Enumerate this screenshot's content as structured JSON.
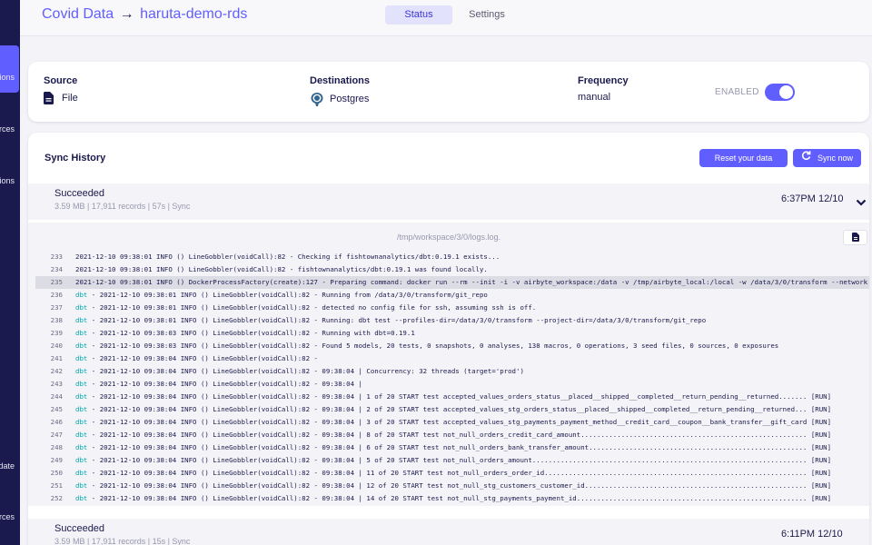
{
  "sidebar": {
    "items": [
      {
        "label": "Connections"
      },
      {
        "label": "Sources"
      },
      {
        "label": "Destinations"
      },
      {
        "label": "Update"
      },
      {
        "label": "Resources"
      }
    ]
  },
  "header": {
    "source_name": "Covid Data",
    "arrow": "→",
    "destination_name": "haruta-demo-rds",
    "tabs": [
      {
        "label": "Status",
        "active": true
      },
      {
        "label": "Settings",
        "active": false
      }
    ]
  },
  "connection": {
    "source_label": "Source",
    "source_value": "File",
    "destinations_label": "Destinations",
    "destinations_value": "Postgres",
    "frequency_label": "Frequency",
    "frequency_value": "manual",
    "enabled_label": "ENABLED",
    "enabled": true
  },
  "history": {
    "title": "Sync History",
    "reset_label": "Reset your data",
    "sync_label": "Sync now",
    "jobs": [
      {
        "status": "Succeeded",
        "meta": "3.59 MB | 17,911 records | 57s | Sync",
        "time": "6:37PM 12/10"
      },
      {
        "status": "Succeeded",
        "meta": "3.59 MB | 17,911 records | 15s | Sync",
        "time": "6:11PM 12/10"
      }
    ],
    "log_path": "/tmp/workspace/3/0/logs.log.",
    "log_lines": [
      {
        "n": "233",
        "dbt": false,
        "text": "2021-12-10 09:38:01 INFO () LineGobbler(voidCall):82 - Checking if fishtownanalytics/dbt:0.19.1 exists..."
      },
      {
        "n": "234",
        "dbt": false,
        "text": "2021-12-10 09:38:01 INFO () LineGobbler(voidCall):82 - fishtownanalytics/dbt:0.19.1 was found locally."
      },
      {
        "n": "235",
        "dbt": false,
        "hl": true,
        "text": "2021-12-10 09:38:01 INFO () DockerProcessFactory(create):127 - Preparing command: docker run --rm --init -i -v airbyte_workspace:/data -v /tmp/airbyte_local:/local -w /data/3/0/transform --network"
      },
      {
        "n": "236",
        "dbt": true,
        "text": " - 2021-12-10 09:38:01 INFO () LineGobbler(voidCall):82 - Running from /data/3/0/transform/git_repo"
      },
      {
        "n": "237",
        "dbt": true,
        "text": " - 2021-12-10 09:38:01 INFO () LineGobbler(voidCall):82 - detected no config file for ssh, assuming ssh is off."
      },
      {
        "n": "238",
        "dbt": true,
        "text": " - 2021-12-10 09:38:01 INFO () LineGobbler(voidCall):82 - Running: dbt test --profiles-dir=/data/3/0/transform --project-dir=/data/3/0/transform/git_repo"
      },
      {
        "n": "239",
        "dbt": true,
        "text": " - 2021-12-10 09:38:03 INFO () LineGobbler(voidCall):82 - Running with dbt=0.19.1"
      },
      {
        "n": "240",
        "dbt": true,
        "text": " - 2021-12-10 09:38:03 INFO () LineGobbler(voidCall):82 - Found 5 models, 20 tests, 0 snapshots, 0 analyses, 138 macros, 0 operations, 3 seed files, 0 sources, 0 exposures"
      },
      {
        "n": "241",
        "dbt": true,
        "text": " - 2021-12-10 09:38:04 INFO () LineGobbler(voidCall):82 -"
      },
      {
        "n": "242",
        "dbt": true,
        "text": " - 2021-12-10 09:38:04 INFO () LineGobbler(voidCall):82 - 09:38:04 | Concurrency: 32 threads (target='prod')"
      },
      {
        "n": "243",
        "dbt": true,
        "text": " - 2021-12-10 09:38:04 INFO () LineGobbler(voidCall):82 - 09:38:04 |"
      },
      {
        "n": "244",
        "dbt": true,
        "text": " - 2021-12-10 09:38:04 INFO () LineGobbler(voidCall):82 - 09:38:04 | 1 of 20 START test accepted_values_orders_status__placed__shipped__completed__return_pending__returned....... [RUN]"
      },
      {
        "n": "245",
        "dbt": true,
        "text": " - 2021-12-10 09:38:04 INFO () LineGobbler(voidCall):82 - 09:38:04 | 2 of 20 START test accepted_values_stg_orders_status__placed__shipped__completed__return_pending__returned... [RUN]"
      },
      {
        "n": "246",
        "dbt": true,
        "text": " - 2021-12-10 09:38:04 INFO () LineGobbler(voidCall):82 - 09:38:04 | 3 of 20 START test accepted_values_stg_payments_payment_method__credit_card__coupon__bank_transfer__gift_card [RUN]"
      },
      {
        "n": "247",
        "dbt": true,
        "text": " - 2021-12-10 09:38:04 INFO () LineGobbler(voidCall):82 - 09:38:04 | 8 of 20 START test not_null_orders_credit_card_amount........................................................ [RUN]"
      },
      {
        "n": "248",
        "dbt": true,
        "text": " - 2021-12-10 09:38:04 INFO () LineGobbler(voidCall):82 - 09:38:04 | 6 of 20 START test not_null_orders_bank_transfer_amount...................................................... [RUN]"
      },
      {
        "n": "249",
        "dbt": true,
        "text": " - 2021-12-10 09:38:04 INFO () LineGobbler(voidCall):82 - 09:38:04 | 5 of 20 START test not_null_orders_amount.................................................................... [RUN]"
      },
      {
        "n": "250",
        "dbt": true,
        "text": " - 2021-12-10 09:38:04 INFO () LineGobbler(voidCall):82 - 09:38:04 | 11 of 20 START test not_null_orders_order_id................................................................. [RUN]"
      },
      {
        "n": "251",
        "dbt": true,
        "text": " - 2021-12-10 09:38:04 INFO () LineGobbler(voidCall):82 - 09:38:04 | 12 of 20 START test not_null_stg_customers_customer_id....................................................... [RUN]"
      },
      {
        "n": "252",
        "dbt": true,
        "text": " - 2021-12-10 09:38:04 INFO () LineGobbler(voidCall):82 - 09:38:04 | 14 of 20 START test not_null_stg_payments_payment_id......................................................... [RUN]"
      }
    ],
    "dbt_tag": "dbt"
  },
  "colors": {
    "accent": "#615eff",
    "sidebar": "#1a1a4f",
    "text": "#1a194d",
    "dbt": "#00a8ab"
  }
}
